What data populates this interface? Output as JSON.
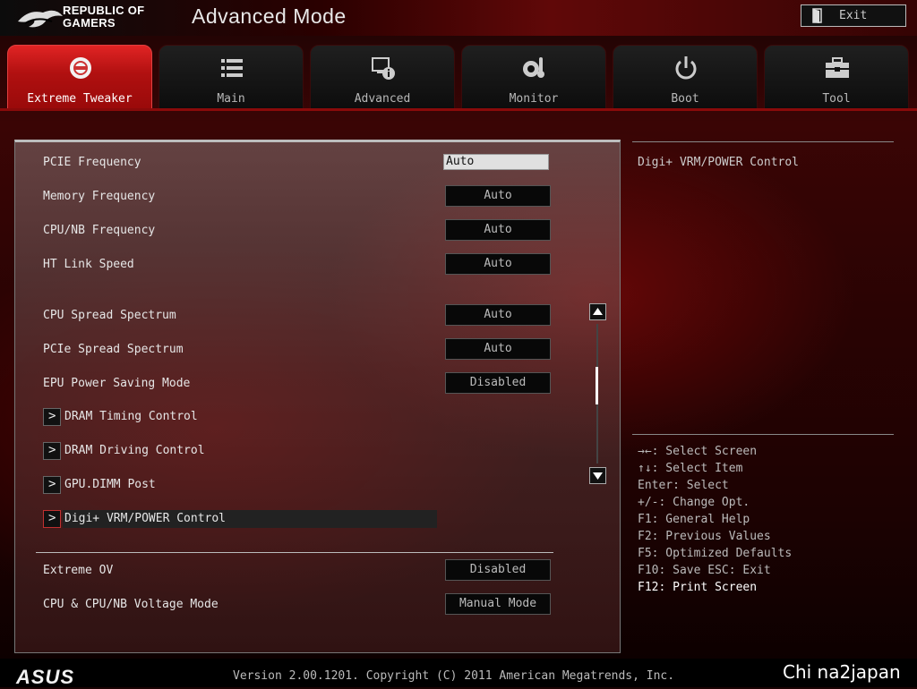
{
  "header": {
    "brand_line1": "REPUBLIC OF",
    "brand_line2": "GAMERS",
    "mode_title": "Advanced Mode",
    "exit_label": "Exit"
  },
  "tabs": [
    {
      "label": "Extreme Tweaker",
      "icon": "extreme-tweaker-icon",
      "active": true
    },
    {
      "label": "Main",
      "icon": "list-icon",
      "active": false
    },
    {
      "label": "Advanced",
      "icon": "advanced-settings-icon",
      "active": false
    },
    {
      "label": "Monitor",
      "icon": "monitor-thermometer-icon",
      "active": false
    },
    {
      "label": "Boot",
      "icon": "power-icon",
      "active": false
    },
    {
      "label": "Tool",
      "icon": "toolbox-icon",
      "active": false
    }
  ],
  "settings": [
    {
      "label": "PCIE Frequency",
      "value": "Auto"
    },
    {
      "label": "Memory Frequency",
      "value": "Auto"
    },
    {
      "label": "CPU/NB Frequency",
      "value": "Auto"
    },
    {
      "label": "HT Link Speed",
      "value": "Auto"
    },
    {
      "label": "CPU Spread Spectrum",
      "value": "Auto"
    },
    {
      "label": "PCIe Spread Spectrum",
      "value": "Auto"
    },
    {
      "label": "EPU Power Saving Mode",
      "value": "Disabled"
    }
  ],
  "submenus": [
    {
      "label": "DRAM Timing Control"
    },
    {
      "label": "DRAM Driving Control"
    },
    {
      "label": "GPU.DIMM Post"
    },
    {
      "label": "Digi+ VRM/POWER Control",
      "selected": true
    }
  ],
  "extra_settings": [
    {
      "label": "Extreme OV",
      "value": "Disabled"
    },
    {
      "label": "CPU & CPU/NB Voltage Mode",
      "value": "Manual Mode"
    }
  ],
  "help": {
    "title": "Digi+ VRM/POWER Control"
  },
  "keys": [
    "→←: Select Screen",
    "↑↓: Select Item",
    "Enter: Select",
    "+/-: Change Opt.",
    "F1: General Help",
    "F2: Previous Values",
    "F5: Optimized Defaults",
    "F10: Save  ESC: Exit",
    "F12: Print Screen"
  ],
  "footer": {
    "brand": "ASUS",
    "version": "Version 2.00.1201. Copyright (C) 2011 American Megatrends, Inc.",
    "watermark": "Chi na2japan"
  },
  "scroll": {
    "position_fraction": 0.35
  },
  "colors": {
    "accent_red": "#c41414",
    "tab_active": "#d21e1e",
    "background_dark": "#1a0303"
  }
}
